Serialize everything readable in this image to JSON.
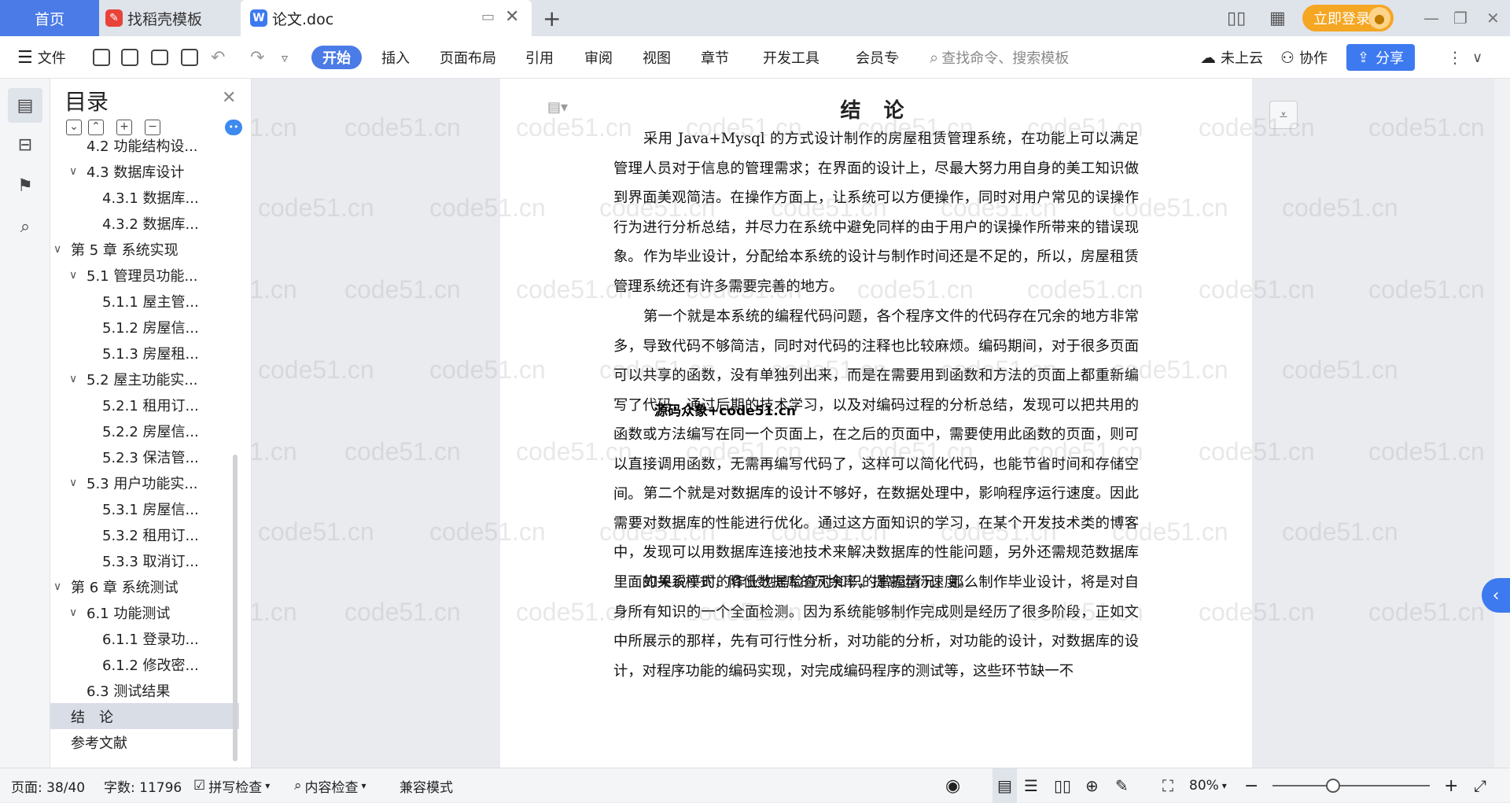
{
  "tabs": {
    "home": "首页",
    "docer": "找稻壳模板",
    "doc": "论文.doc",
    "new_tab": "+"
  },
  "titlebar": {
    "login": "立即登录"
  },
  "toolbar": {
    "file": "文件",
    "start": "开始",
    "insert": "插入",
    "layout": "页面布局",
    "reference": "引用",
    "review": "审阅",
    "view": "视图",
    "chapter": "章节",
    "devtools": "开发工具",
    "member": "会员专",
    "search_placeholder": "查找命令、搜索模板",
    "cloud": "未上云",
    "collab": "协作",
    "share": "分享"
  },
  "toc": {
    "title": "目录",
    "items": [
      {
        "label": "4.2 功能结构设...",
        "level": 2,
        "arrow": ""
      },
      {
        "label": "4.3 数据库设计",
        "level": 2,
        "arrow": "∨"
      },
      {
        "label": "4.3.1 数据库...",
        "level": 3,
        "arrow": ""
      },
      {
        "label": "4.3.2 数据库...",
        "level": 3,
        "arrow": ""
      },
      {
        "label": "第 5 章 系统实现",
        "level": 1,
        "arrow": "∨"
      },
      {
        "label": "5.1 管理员功能...",
        "level": 2,
        "arrow": "∨"
      },
      {
        "label": "5.1.1 屋主管...",
        "level": 3,
        "arrow": ""
      },
      {
        "label": "5.1.2 房屋信...",
        "level": 3,
        "arrow": ""
      },
      {
        "label": "5.1.3 房屋租...",
        "level": 3,
        "arrow": ""
      },
      {
        "label": "5.2 屋主功能实...",
        "level": 2,
        "arrow": "∨"
      },
      {
        "label": "5.2.1 租用订...",
        "level": 3,
        "arrow": ""
      },
      {
        "label": "5.2.2 房屋信...",
        "level": 3,
        "arrow": ""
      },
      {
        "label": "5.2.3 保洁管...",
        "level": 3,
        "arrow": ""
      },
      {
        "label": "5.3 用户功能实...",
        "level": 2,
        "arrow": "∨"
      },
      {
        "label": "5.3.1 房屋信...",
        "level": 3,
        "arrow": ""
      },
      {
        "label": "5.3.2 租用订...",
        "level": 3,
        "arrow": ""
      },
      {
        "label": "5.3.3 取消订...",
        "level": 3,
        "arrow": ""
      },
      {
        "label": "第 6 章 系统测试",
        "level": 1,
        "arrow": "∨"
      },
      {
        "label": "6.1 功能测试",
        "level": 2,
        "arrow": "∨"
      },
      {
        "label": "6.1.1 登录功...",
        "level": 3,
        "arrow": ""
      },
      {
        "label": "6.1.2 修改密...",
        "level": 3,
        "arrow": ""
      },
      {
        "label": "6.3 测试结果",
        "level": 2,
        "arrow": ""
      },
      {
        "label": "结　论",
        "level": 1,
        "arrow": "",
        "selected": true
      },
      {
        "label": "参考文献",
        "level": 1,
        "arrow": ""
      }
    ]
  },
  "document": {
    "title": "结 论",
    "paragraphs": [
      "采用 Java+Mysql 的方式设计制作的房屋租赁管理系统，在功能上可以满足管理人员对于信息的管理需求；在界面的设计上，尽最大努力用自身的美工知识做到界面美观简洁。在操作方面上，让系统可以方便操作，同时对用户常见的误操作行为进行分析总结，并尽力在系统中避免同样的由于用户的误操作所带来的错误现象。",
      "作为毕业设计，分配给本系统的设计与制作时间还是不足的，所以，房屋租赁管理系统还有许多需要完善的地方。",
      "第一个就是本系统的编程代码问题，各个程序文件的代码存在冗余的地方非常多，导致代码不够简洁，同时对代码的注释也比较麻烦。编码期间，对于很多页面可以共享的函数，没有单独列出来，而是在需要用到函数和方法的页面上都重新编写了代码，通过后期的技术学习，以及对编码过程的分析总结，发现可以把共用的函数或方法编写在同一个页面上，在之后的页面中，需要使用此函数的页面，则可以直接调用函数，无需再编写代码了，这样可以简化代码，也能节省时间和存储空间。",
      "第二个就是对数据库的设计不够好，在数据处理中，影响程序运行速度。因此需要对数据库的性能进行优化。通过这方面知识的学习，在某个开发技术类的博客中，发现可以用数据库连接池技术来解决数据库的性能问题，另外还需规范数据库里面的关系模式，降低数据库的冗余率，提高运行速度。",
      "如果说平时的作业也是检查对知识的掌握情况，那么制作毕业设计，将是对自身所有知识的一个全面检测。因为系统能够制作完成则是经历了很多阶段，正如文中所展示的那样，先有可行性分析，对功能的分析，对功能的设计，对数据库的设计，对程序功能的编码实现，对完成编码程序的测试等，这些环节缺一不"
    ],
    "overlay": "源码众象+code51.cn",
    "watermark": "code51.cn"
  },
  "status": {
    "page": "页面: 38/40",
    "words": "字数: 11796",
    "spell": "拼写检查",
    "content_check": "内容检查",
    "compat": "兼容模式",
    "zoom": "80%"
  }
}
